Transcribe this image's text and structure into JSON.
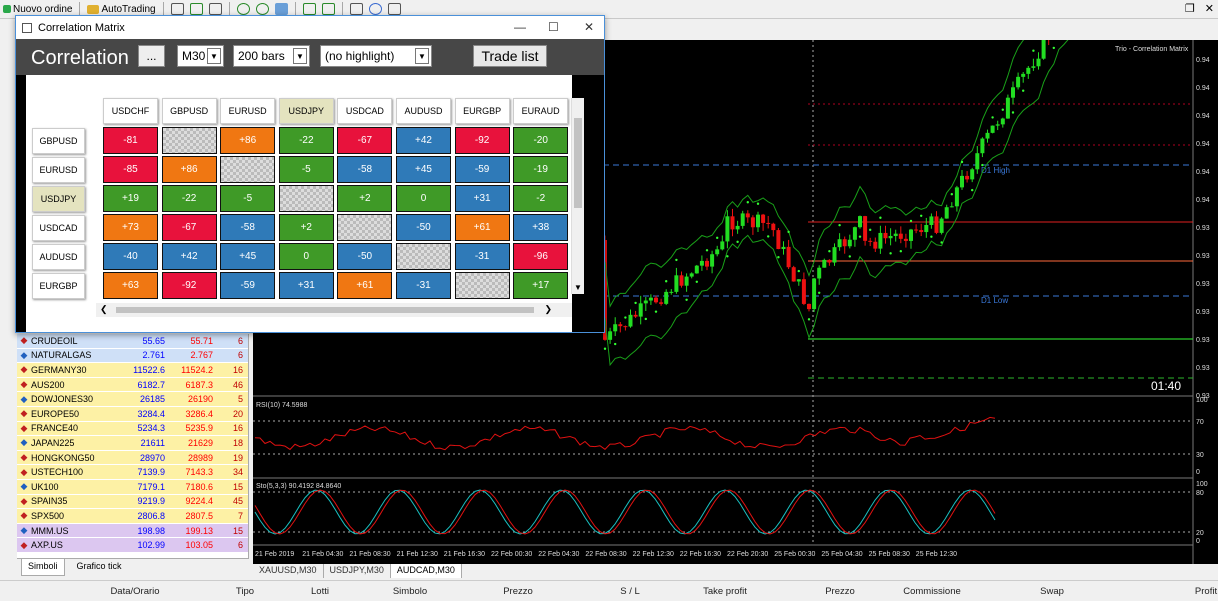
{
  "toolbar": {
    "new_order": "Nuovo ordine",
    "autotrading": "AutoTrading"
  },
  "dialog": {
    "title": "Correlation Matrix",
    "heading": "Correlation",
    "dots_button": "...",
    "timeframe": "M30",
    "bars": "200 bars",
    "highlight": "(no highlight)",
    "trade_list": "Trade list",
    "columns": [
      "USDCHF",
      "GBPUSD",
      "EURUSD",
      "USDJPY",
      "USDCAD",
      "AUDUSD",
      "EURGBP",
      "EURAUD"
    ],
    "highlight_col": "USDJPY",
    "rows": [
      {
        "label": "GBPUSD",
        "cells": [
          "-81",
          "",
          "+86",
          "-22",
          "-67",
          "+42",
          "-92",
          "-20"
        ]
      },
      {
        "label": "EURUSD",
        "cells": [
          "-85",
          "+86",
          "",
          "-5",
          "-58",
          "+45",
          "-59",
          "-19"
        ]
      },
      {
        "label": "USDJPY",
        "cells": [
          "+19",
          "-22",
          "-5",
          "",
          "+2",
          "0",
          "+31",
          "-2"
        ]
      },
      {
        "label": "USDCAD",
        "cells": [
          "+73",
          "-67",
          "-58",
          "+2",
          "",
          "-50",
          "+61",
          "+38"
        ]
      },
      {
        "label": "AUDUSD",
        "cells": [
          "-40",
          "+42",
          "+45",
          "0",
          "-50",
          "",
          "-31",
          "-96"
        ]
      },
      {
        "label": "EURGBP",
        "cells": [
          "+63",
          "-92",
          "-59",
          "+31",
          "+61",
          "-31",
          "",
          "+17"
        ]
      }
    ],
    "colors": {
      "red": "#e8123c",
      "orange": "#f07712",
      "green": "#3f9a27",
      "blue": "#2f7ab8"
    }
  },
  "watchlist": [
    {
      "symbol": "CRUDEOIL",
      "bid": "55.65",
      "ask": "55.71",
      "spread": "6"
    },
    {
      "symbol": "NATURALGAS",
      "bid": "2.761",
      "ask": "2.767",
      "spread": "6"
    },
    {
      "symbol": "GERMANY30",
      "bid": "11522.6",
      "ask": "11524.2",
      "spread": "16"
    },
    {
      "symbol": "AUS200",
      "bid": "6182.7",
      "ask": "6187.3",
      "spread": "46"
    },
    {
      "symbol": "DOWJONES30",
      "bid": "26185",
      "ask": "26190",
      "spread": "5"
    },
    {
      "symbol": "EUROPE50",
      "bid": "3284.4",
      "ask": "3286.4",
      "spread": "20"
    },
    {
      "symbol": "FRANCE40",
      "bid": "5234.3",
      "ask": "5235.9",
      "spread": "16"
    },
    {
      "symbol": "JAPAN225",
      "bid": "21611",
      "ask": "21629",
      "spread": "18"
    },
    {
      "symbol": "HONGKONG50",
      "bid": "28970",
      "ask": "28989",
      "spread": "19"
    },
    {
      "symbol": "USTECH100",
      "bid": "7139.9",
      "ask": "7143.3",
      "spread": "34"
    },
    {
      "symbol": "UK100",
      "bid": "7179.1",
      "ask": "7180.6",
      "spread": "15"
    },
    {
      "symbol": "SPAIN35",
      "bid": "9219.9",
      "ask": "9224.4",
      "spread": "45"
    },
    {
      "symbol": "SPX500",
      "bid": "2806.8",
      "ask": "2807.5",
      "spread": "7"
    },
    {
      "symbol": "MMM.US",
      "bid": "198.98",
      "ask": "199.13",
      "spread": "15"
    },
    {
      "symbol": "AXP.US",
      "bid": "102.99",
      "ask": "103.05",
      "spread": "6"
    }
  ],
  "watch_tabs": [
    "Simboli",
    "Grafico tick"
  ],
  "chart": {
    "indicator_label": "Trio - Correlation Matrix",
    "d1_high": "D1 High",
    "d1_low": "D1 Low",
    "timer": "01:40",
    "rsi_label": "RSI(10) 74.5988",
    "sto_label": "Sto(5,3,3) 90.4192 84.8640",
    "price_ticks": [
      "0.94",
      "0.94",
      "0.94",
      "0.94",
      "0.94",
      "0.94",
      "0.93",
      "0.93",
      "0.93",
      "0.93",
      "0.93",
      "0.93",
      "0.93"
    ],
    "rsi_ticks": [
      "100",
      "70",
      "30",
      "0"
    ],
    "sto_ticks": [
      "100",
      "80",
      "20",
      "0"
    ],
    "time_ticks": [
      "21 Feb 2019",
      "21 Feb 04:30",
      "21 Feb 08:30",
      "21 Feb 12:30",
      "21 Feb 16:30",
      "22 Feb 00:30",
      "22 Feb 04:30",
      "22 Feb 08:30",
      "22 Feb 12:30",
      "22 Feb 16:30",
      "22 Feb 20:30",
      "25 Feb 00:30",
      "25 Feb 04:30",
      "25 Feb 08:30",
      "25 Feb 12:30"
    ]
  },
  "chart_tabs": [
    "XAUUSD,M30",
    "USDJPY,M30",
    "AUDCAD,M30"
  ],
  "terminal_columns": [
    "Data/Orario",
    "Tipo",
    "Lotti",
    "Simbolo",
    "Prezzo",
    "S / L",
    "Take profit",
    "Prezzo",
    "Commissione",
    "Swap",
    "Profit"
  ]
}
